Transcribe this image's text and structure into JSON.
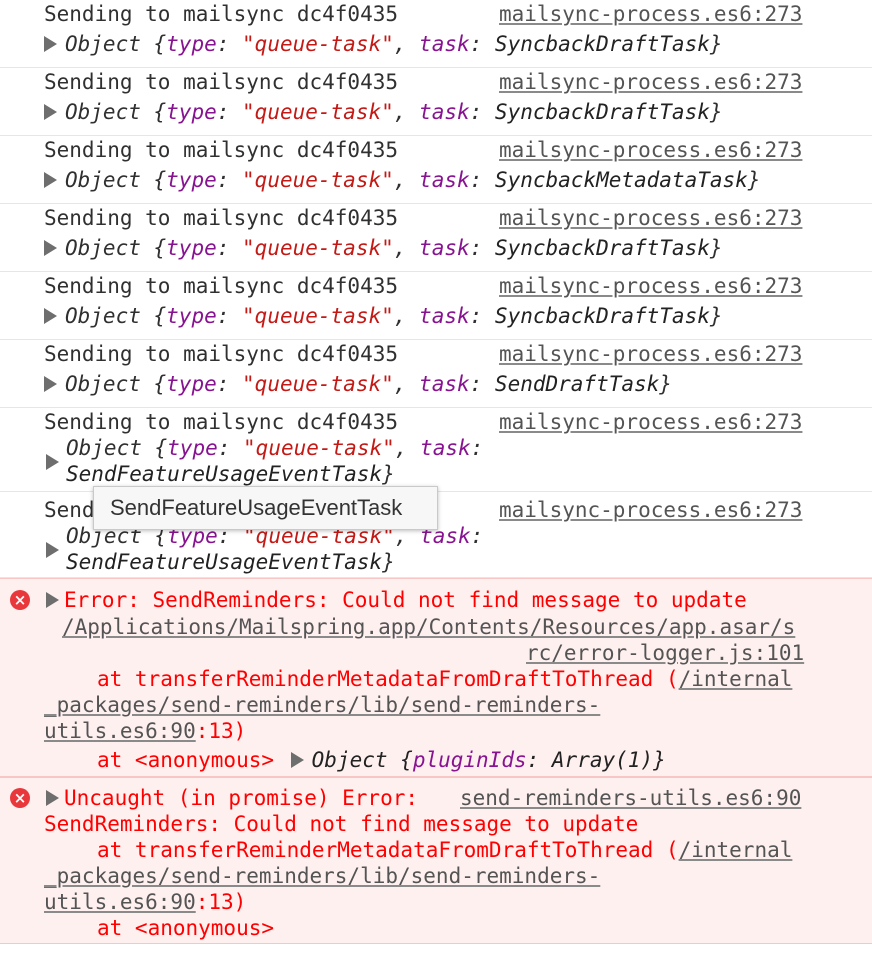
{
  "log_rows": [
    {
      "message": "Sending to mailsync dc4f0435",
      "source": "mailsync-process.es6:273",
      "object_prefix": "Object {",
      "type_key": "type",
      "type_value": "\"queue-task\"",
      "task_key": "task",
      "task_value": "SyncbackDraftTask",
      "object_suffix": "}"
    },
    {
      "message": "Sending to mailsync dc4f0435",
      "source": "mailsync-process.es6:273",
      "object_prefix": "Object {",
      "type_key": "type",
      "type_value": "\"queue-task\"",
      "task_key": "task",
      "task_value": "SyncbackDraftTask",
      "object_suffix": "}"
    },
    {
      "message": "Sending to mailsync dc4f0435",
      "source": "mailsync-process.es6:273",
      "object_prefix": "Object {",
      "type_key": "type",
      "type_value": "\"queue-task\"",
      "task_key": "task",
      "task_value": "SyncbackMetadataTask",
      "object_suffix": "}"
    },
    {
      "message": "Sending to mailsync dc4f0435",
      "source": "mailsync-process.es6:273",
      "object_prefix": "Object {",
      "type_key": "type",
      "type_value": "\"queue-task\"",
      "task_key": "task",
      "task_value": "SyncbackDraftTask",
      "object_suffix": "}"
    },
    {
      "message": "Sending to mailsync dc4f0435",
      "source": "mailsync-process.es6:273",
      "object_prefix": "Object {",
      "type_key": "type",
      "type_value": "\"queue-task\"",
      "task_key": "task",
      "task_value": "SyncbackDraftTask",
      "object_suffix": "}"
    },
    {
      "message": "Sending to mailsync dc4f0435",
      "source": "mailsync-process.es6:273",
      "object_prefix": "Object {",
      "type_key": "type",
      "type_value": "\"queue-task\"",
      "task_key": "task",
      "task_value": "SendDraftTask",
      "object_suffix": "}"
    },
    {
      "message": "Sending to mailsync dc4f0435",
      "source": "mailsync-process.es6:273",
      "object_prefix": "Object {",
      "type_key": "type",
      "type_value": "\"queue-task\"",
      "task_key": "task",
      "task_value": "SendFeatureUsageEventTask",
      "object_suffix": "}"
    },
    {
      "message": "Send",
      "source": "mailsync-process.es6:273",
      "object_prefix": "Object {",
      "type_key": "type",
      "type_value": "\"queue-task\"",
      "task_key": "task",
      "task_value": "SendFeatureUsageEventTask",
      "object_suffix": "}"
    }
  ],
  "tooltip": {
    "text": "SendFeatureUsageEventTask"
  },
  "error1": {
    "message": "Error: SendReminders: Could not find message to update",
    "path_line1": "/Applications/Mailspring.app/Contents/Resources/app.asar/s",
    "path_line2": "rc/error-logger.js:101",
    "at1_prefix": "at transferReminderMetadataFromDraftToThread (",
    "at1_link_a": "/internal",
    "at1_link_b": "_packages/send-reminders/lib/send-reminders-",
    "at1_link_c": "utils.es6:90",
    "at1_suffix": ":13)",
    "at2_prefix": "at <anonymous> ",
    "at2_object_prefix": "Object {",
    "at2_key": "pluginIds",
    "at2_value": "Array(1)",
    "at2_object_suffix": "}"
  },
  "error2": {
    "message_line1": "Uncaught (in promise) Error: ",
    "source": "send-reminders-utils.es6:90",
    "message_line2": "SendReminders: Could not find message to update",
    "at1_prefix": "at transferReminderMetadataFromDraftToThread (",
    "at1_link_a": "/internal",
    "at1_link_b": "_packages/send-reminders/lib/send-reminders-",
    "at1_link_c": "utils.es6:90",
    "at1_suffix": ":13)",
    "at2": "at <anonymous>"
  },
  "icons": {
    "error": "error-circle-icon",
    "expand": "triangle-right-icon"
  },
  "colors": {
    "error_bg": "#fff0f0",
    "error_text": "#ff0000",
    "key": "#881391",
    "string": "#c41a16"
  }
}
